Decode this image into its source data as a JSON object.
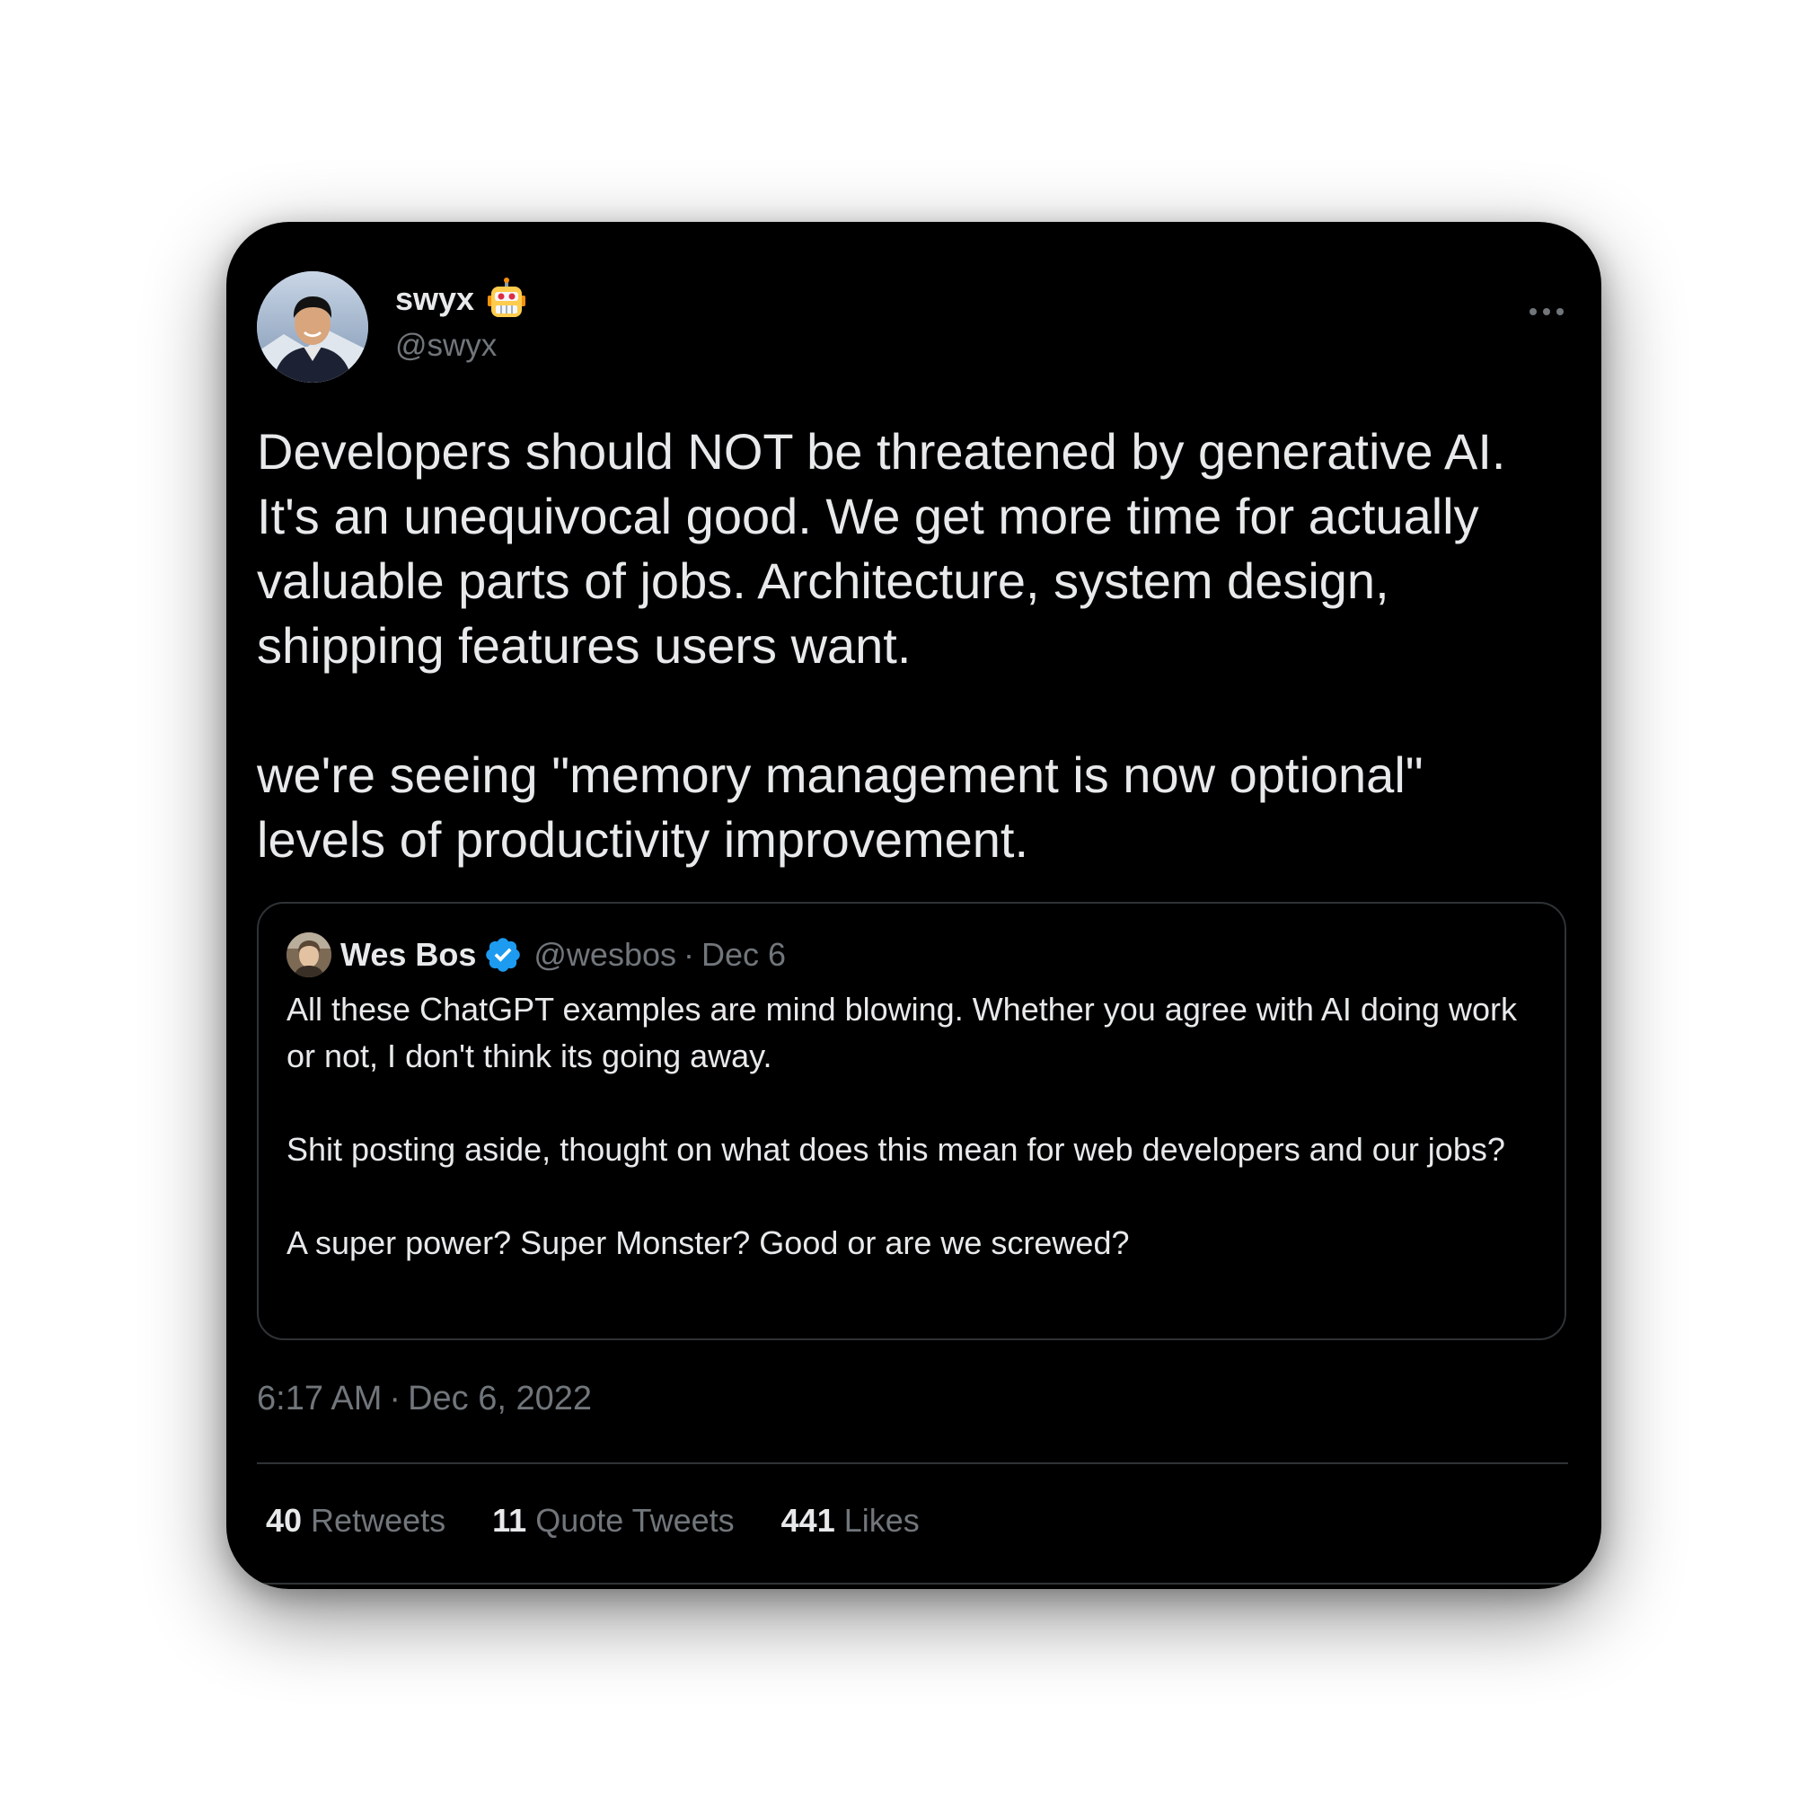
{
  "author": {
    "display_name": "swyx",
    "name_emoji": "robot-face-emoji",
    "handle": "@swyx"
  },
  "tweet": {
    "text": "Developers should NOT be threatened by generative AI. It's an unequivocal good. We get more time for actually valuable parts of jobs. Architecture, system design, shipping features users want.\n\nwe're seeing \"memory management is now optional\" levels of productivity improvement.",
    "time": "6:17 AM",
    "separator": "·",
    "date": "Dec 6, 2022"
  },
  "quoted_tweet": {
    "display_name": "Wes Bos",
    "verified": true,
    "handle": "@wesbos",
    "separator": "·",
    "date": "Dec 6",
    "text": "All these ChatGPT examples are mind blowing. Whether you agree with AI doing work or not, I don't think its going away.\n\nShit posting aside, thought on what does this mean for web developers and our jobs?\n\nA super power? Super Monster? Good or are we screwed?"
  },
  "stats": {
    "retweets": {
      "count": "40",
      "label": "Retweets"
    },
    "quote_tweets": {
      "count": "11",
      "label": "Quote Tweets"
    },
    "likes": {
      "count": "441",
      "label": "Likes"
    }
  },
  "colors": {
    "card_bg": "#000000",
    "primary_text": "#e7e9ea",
    "secondary_text": "#71767b",
    "border": "#2f3336",
    "verified_blue": "#1d9bf0"
  }
}
